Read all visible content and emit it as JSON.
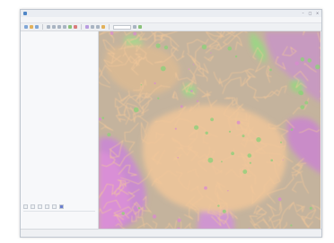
{
  "window": {
    "title": ""
  },
  "menu": [],
  "panel": {
    "tabs": [],
    "pills": [],
    "tree": []
  },
  "properties": [],
  "status": {
    "fields": [],
    "coords": ""
  },
  "colors": {
    "map_background": "#c9b7a1",
    "vector_lines": "#f2c79a",
    "vegetation": "#8fd07a",
    "pink_class": "#d98ad0",
    "accent": "#2f6db4"
  }
}
